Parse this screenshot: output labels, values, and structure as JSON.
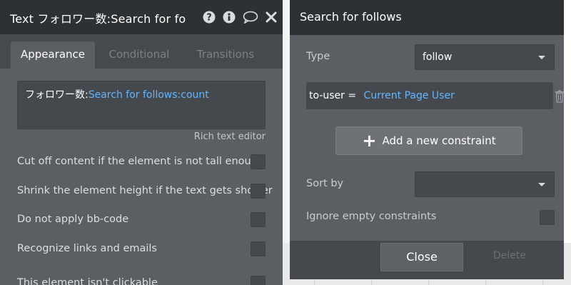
{
  "left_panel": {
    "title": "Text フォロワー数:Search for fo",
    "header_icons": [
      "help-icon",
      "info-icon",
      "comment-icon",
      "close-icon"
    ],
    "tabs": [
      {
        "label": "Appearance",
        "active": true
      },
      {
        "label": "Conditional",
        "active": false
      },
      {
        "label": "Transitions",
        "active": false
      }
    ],
    "content": {
      "static_text": "フォロワー数:",
      "dynamic_text": "Search for follows:count"
    },
    "rich_text_editor_link": "Rich text editor",
    "options": [
      {
        "label": "Cut off content if the element is not tall enough",
        "checked": false
      },
      {
        "label": "Shrink the element height if the text gets shorter",
        "checked": false
      },
      {
        "label": "Do not apply bb-code",
        "checked": false
      },
      {
        "label": "Recognize links and emails",
        "checked": false
      },
      {
        "label": "This element isn't clickable",
        "checked": false
      }
    ]
  },
  "right_panel": {
    "title": "Search for follows",
    "type_label": "Type",
    "type_value": "follow",
    "constraint": {
      "field": "to-user",
      "operator": "=",
      "value": "Current Page User"
    },
    "add_constraint_label": "Add a new constraint",
    "sort_by_label": "Sort by",
    "sort_by_value": "",
    "ignore_empty_label": "Ignore empty constraints",
    "ignore_empty_checked": false,
    "close_label": "Close",
    "delete_label": "Delete"
  },
  "colors": {
    "panel_bg": "#5b5f63",
    "header_bg": "#2e3134",
    "field_bg": "#45494d",
    "dynamic_text": "#62b6ff"
  }
}
